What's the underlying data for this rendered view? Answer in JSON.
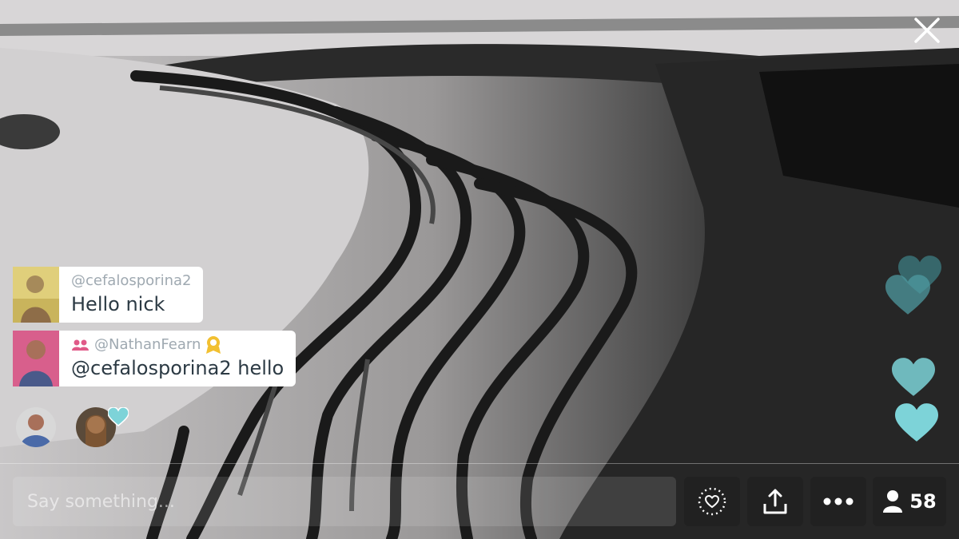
{
  "close": {
    "icon": "close-icon"
  },
  "chat": [
    {
      "user": "@cefalosporina2",
      "text": "Hello nick",
      "icon": null
    },
    {
      "user": "@NathanFearn",
      "text": "@cefalosporina2 hello",
      "icon": "people-icon",
      "badge": "superfan-badge-icon"
    }
  ],
  "viewers": [
    {
      "name": "viewer-1"
    },
    {
      "name": "viewer-2"
    }
  ],
  "composer": {
    "placeholder": "Say something..."
  },
  "toolbar": {
    "heart": "heart-button",
    "share": "share-button",
    "more": "more-button",
    "viewer_count": "58"
  },
  "colors": {
    "heart": "#7dd3d8",
    "heart_dark": "#3e7e83",
    "chat_user": "#9fa9b1"
  }
}
